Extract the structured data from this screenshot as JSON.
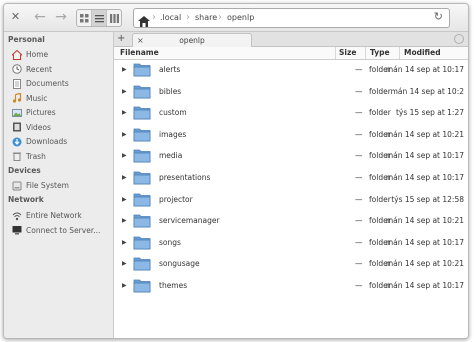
{
  "toolbar": {
    "close_icon": "✕",
    "back_icon": "←",
    "forward_icon": "→",
    "breadcrumbs": [
      ".local",
      "share",
      "openlp"
    ],
    "reload_icon": "↻"
  },
  "sidebar": {
    "sections": [
      {
        "heading": "Personal",
        "items": [
          {
            "label": "Home",
            "icon": "home-icon"
          },
          {
            "label": "Recent",
            "icon": "recent-icon"
          },
          {
            "label": "Documents",
            "icon": "documents-icon"
          },
          {
            "label": "Music",
            "icon": "music-icon"
          },
          {
            "label": "Pictures",
            "icon": "pictures-icon"
          },
          {
            "label": "Videos",
            "icon": "videos-icon"
          },
          {
            "label": "Downloads",
            "icon": "downloads-icon"
          },
          {
            "label": "Trash",
            "icon": "trash-icon"
          }
        ]
      },
      {
        "heading": "Devices",
        "items": [
          {
            "label": "File System",
            "icon": "drive-icon"
          }
        ]
      },
      {
        "heading": "Network",
        "items": [
          {
            "label": "Entire Network",
            "icon": "network-icon"
          },
          {
            "label": "Connect to Server...",
            "icon": "server-icon"
          }
        ]
      }
    ]
  },
  "tabs": {
    "add_icon": "+",
    "items": [
      {
        "label": "openlp",
        "close": "×"
      }
    ]
  },
  "list": {
    "columns": {
      "filename": "Filename",
      "size": "Size",
      "type": "Type",
      "modified": "Modified"
    },
    "rows": [
      {
        "name": "alerts",
        "size": "—",
        "type": "folder",
        "modified": "mán 14 sep at 10:17"
      },
      {
        "name": "bibles",
        "size": "—",
        "type": "folder",
        "modified": "mán 14 sep at 10:2"
      },
      {
        "name": "custom",
        "size": "—",
        "type": "folder",
        "modified": "týs 15 sep at 1:27"
      },
      {
        "name": "images",
        "size": "—",
        "type": "folder",
        "modified": "mán 14 sep at 10:21"
      },
      {
        "name": "media",
        "size": "—",
        "type": "folder",
        "modified": "mán 14 sep at 10:17"
      },
      {
        "name": "presentations",
        "size": "—",
        "type": "folder",
        "modified": "mán 14 sep at 10:17"
      },
      {
        "name": "projector",
        "size": "—",
        "type": "folder",
        "modified": "týs 15 sep at 12:58"
      },
      {
        "name": "servicemanager",
        "size": "—",
        "type": "folder",
        "modified": "mán 14 sep at 10:21"
      },
      {
        "name": "songs",
        "size": "—",
        "type": "folder",
        "modified": "mán 14 sep at 10:17"
      },
      {
        "name": "songusage",
        "size": "—",
        "type": "folder",
        "modified": "mán 14 sep at 10:21"
      },
      {
        "name": "themes",
        "size": "—",
        "type": "folder",
        "modified": "mán 14 sep at 10:17"
      }
    ]
  }
}
